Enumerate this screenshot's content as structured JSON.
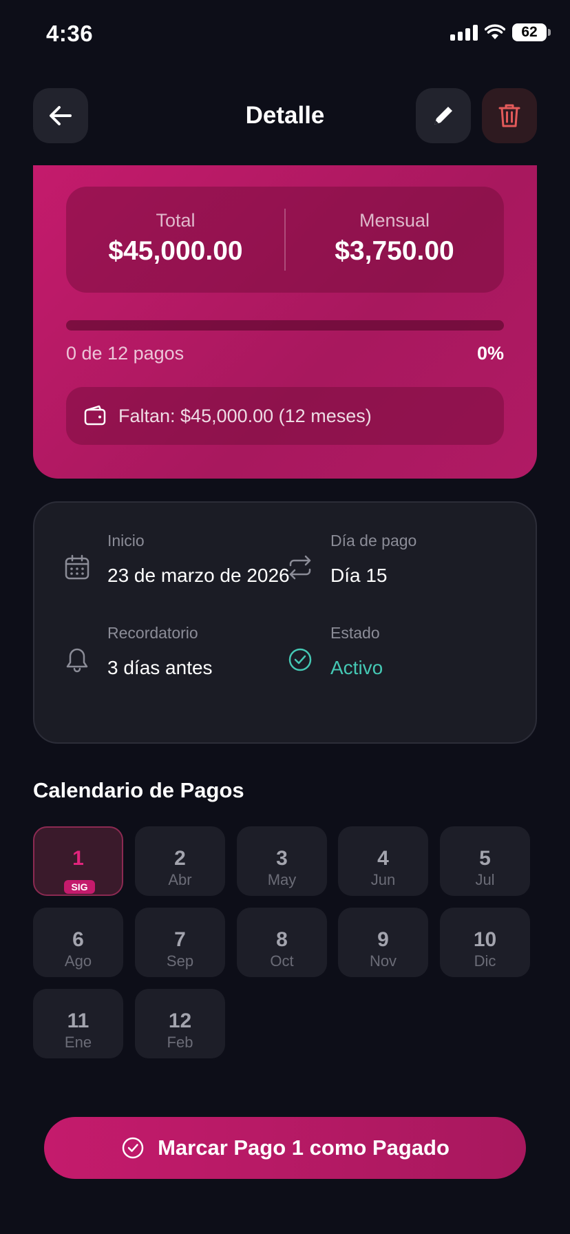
{
  "status_bar": {
    "time": "4:36",
    "battery": "62"
  },
  "header": {
    "title": "Detalle"
  },
  "summary": {
    "total_label": "Total",
    "total_value": "$45,000.00",
    "monthly_label": "Mensual",
    "monthly_value": "$3,750.00",
    "progress_text": "0 de 12 pagos",
    "progress_percent_label": "0%",
    "progress_fraction": 0,
    "remaining_text": "Faltan: $45,000.00 (12 meses)"
  },
  "info": {
    "start_label": "Inicio",
    "start_value": "23 de marzo de 2026",
    "payday_label": "Día de pago",
    "payday_value": "Día 15",
    "reminder_label": "Recordatorio",
    "reminder_value": "3 días antes",
    "status_label": "Estado",
    "status_value": "Activo"
  },
  "calendar": {
    "title": "Calendario de Pagos",
    "next_badge": "SIG",
    "payments": [
      {
        "number": "1",
        "month": ""
      },
      {
        "number": "2",
        "month": "Abr"
      },
      {
        "number": "3",
        "month": "May"
      },
      {
        "number": "4",
        "month": "Jun"
      },
      {
        "number": "5",
        "month": "Jul"
      },
      {
        "number": "6",
        "month": "Ago"
      },
      {
        "number": "7",
        "month": "Sep"
      },
      {
        "number": "8",
        "month": "Oct"
      },
      {
        "number": "9",
        "month": "Nov"
      },
      {
        "number": "10",
        "month": "Dic"
      },
      {
        "number": "11",
        "month": "Ene"
      },
      {
        "number": "12",
        "month": "Feb"
      }
    ]
  },
  "action": {
    "mark_label": "Marcar Pago 1 como Pagado"
  },
  "colors": {
    "accent": "#c41b6c",
    "background": "#0d0e18",
    "active_status": "#45c8b4",
    "delete": "#e35a5a"
  },
  "icons": {
    "back": "arrow-left-icon",
    "edit": "pencil-icon",
    "delete": "trash-icon",
    "wallet": "wallet-icon",
    "calendar": "calendar-icon",
    "repeat": "repeat-icon",
    "bell": "bell-icon",
    "check": "check-circle-icon"
  }
}
